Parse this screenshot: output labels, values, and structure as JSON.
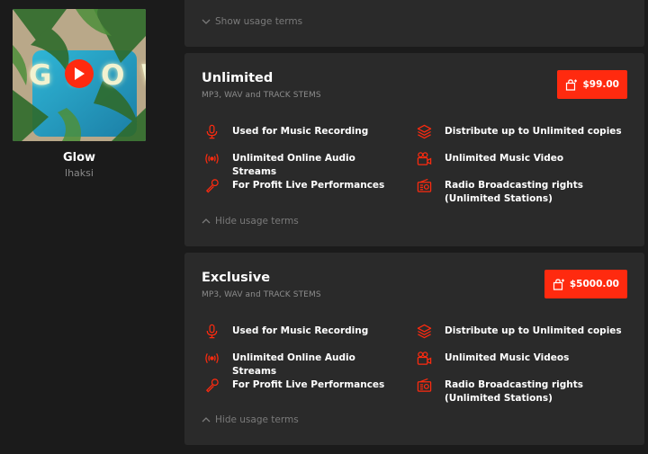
{
  "track": {
    "cover_text": "GLOW",
    "title": "Glow",
    "artist": "lhaksi"
  },
  "colors": {
    "accent": "#ff2a0f",
    "card_bg": "#2a2a2a",
    "page_bg": "#1b1b1b"
  },
  "collapsed_card": {
    "toggle_label": "Show usage terms",
    "toggle_icon": "chevron-down-icon"
  },
  "licenses": [
    {
      "name": "Unlimited",
      "formats": "MP3, WAV and TRACK STEMS",
      "price": "$99.00",
      "toggle_label": "Hide usage terms",
      "features": [
        {
          "icon": "microphone-icon",
          "text": "Used for Music Recording"
        },
        {
          "icon": "broadcast-icon",
          "text": "Unlimited Online Audio Streams"
        },
        {
          "icon": "live-mic-icon",
          "text": "For Profit Live Performances"
        },
        {
          "icon": "layers-icon",
          "text": "Distribute up to Unlimited copies"
        },
        {
          "icon": "video-camera-icon",
          "text": "Unlimited Music Video"
        },
        {
          "icon": "radio-icon",
          "text": "Radio Broadcasting rights (Unlimited Stations)"
        }
      ]
    },
    {
      "name": "Exclusive",
      "formats": "MP3, WAV and TRACK STEMS",
      "price": "$5000.00",
      "toggle_label": "Hide usage terms",
      "features": [
        {
          "icon": "microphone-icon",
          "text": "Used for Music Recording"
        },
        {
          "icon": "broadcast-icon",
          "text": "Unlimited Online Audio Streams"
        },
        {
          "icon": "live-mic-icon",
          "text": "For Profit Live Performances"
        },
        {
          "icon": "layers-icon",
          "text": "Distribute up to Unlimited copies"
        },
        {
          "icon": "video-camera-icon",
          "text": "Unlimited Music Videos"
        },
        {
          "icon": "radio-icon",
          "text": "Radio Broadcasting rights (Unlimited Stations)"
        }
      ]
    }
  ]
}
